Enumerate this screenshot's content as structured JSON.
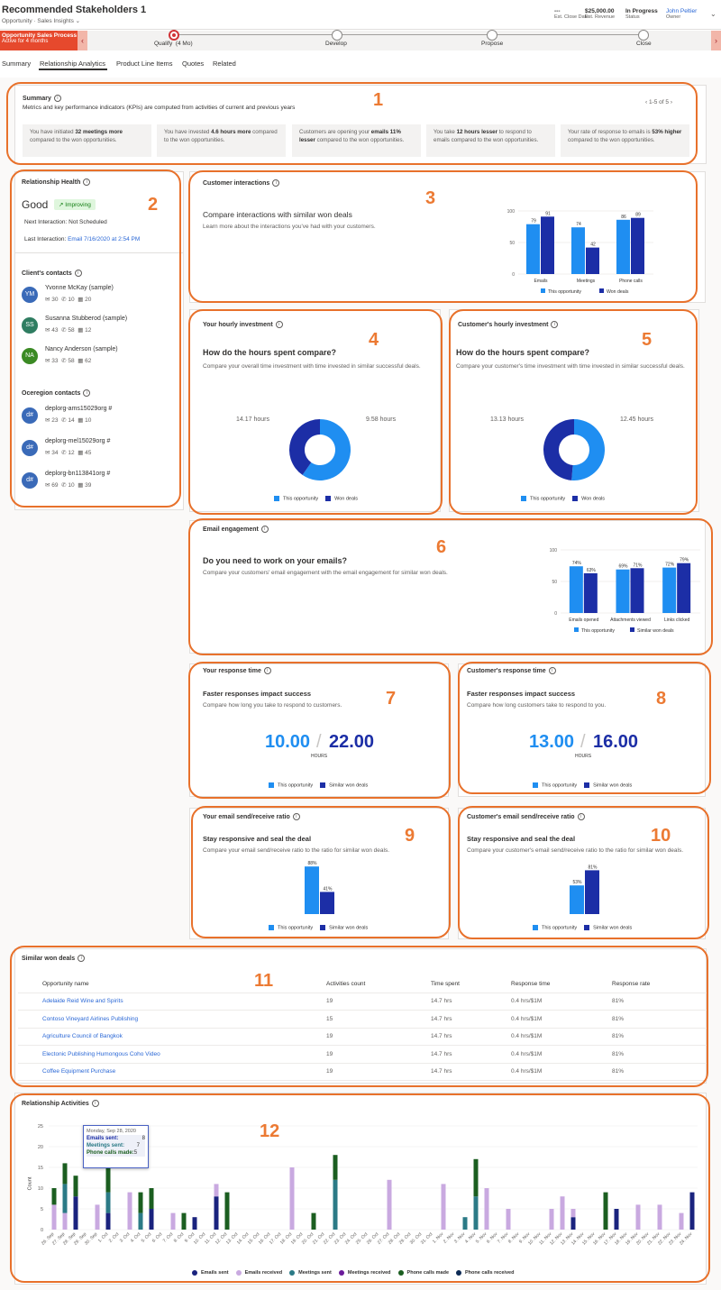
{
  "header": {
    "title": "Recommended Stakeholders 1",
    "entity": "Opportunity",
    "form": "Sales Insights",
    "close_date_value": "---",
    "close_date_label": "Est. Close Date",
    "revenue_value": "$25,000.00",
    "revenue_label": "Est. Revenue",
    "status_value": "In Progress",
    "status_label": "Status",
    "owner_value": "John Peltier",
    "owner_label": "Owner"
  },
  "process": {
    "name": "Opportunity Sales Process",
    "duration": "Active for 4 months",
    "stages": [
      "Qualify  (4 Mo)",
      "Develop",
      "Propose",
      "Close"
    ]
  },
  "tabs": [
    "Summary",
    "Relationship Analytics",
    "Product Line Items",
    "Quotes",
    "Related"
  ],
  "summary": {
    "title": "Summary",
    "desc": "Metrics and key performance indicators (KPIs) are computed from activities of current and previous years",
    "pager": "1-5 of 5",
    "kpis": [
      {
        "a": "You have initiated ",
        "b": "32 meetings more",
        "c": " compared to the won opportunities."
      },
      {
        "a": "You have invested ",
        "b": "4.6 hours more",
        "c": " compared to the won opportunities."
      },
      {
        "a": "Customers are opening your ",
        "b": "emails 11% lesser",
        "c": " compared to the won opportunities."
      },
      {
        "a": "You take ",
        "b": "12 hours lesser",
        "c": " to respond to emails compared to the won opportunities."
      },
      {
        "a": "Your rate of response to emails is ",
        "b": "53% higher",
        "c": " compared to the won opportunities."
      }
    ]
  },
  "health": {
    "title": "Relationship Health",
    "value": "Good",
    "trend": "Improving",
    "next_label": "Next Interaction: Not Scheduled",
    "last_label": "Last Interaction: ",
    "last_value": "Email 7/16/2020 at 2:54 PM",
    "clients_title": "Client's contacts",
    "clients": [
      {
        "initials": "YM",
        "name": "Yvonne McKay (sample)",
        "emails": "30",
        "calls": "10",
        "meetings": "20",
        "color": "#3a6ab8"
      },
      {
        "initials": "SS",
        "name": "Susanna Stubberod (sample)",
        "emails": "43",
        "calls": "58",
        "meetings": "12",
        "color": "#2f7d61"
      },
      {
        "initials": "NA",
        "name": "Nancy Anderson (sample)",
        "emails": "33",
        "calls": "58",
        "meetings": "62",
        "color": "#3b8a24"
      }
    ],
    "org_title": "Oceregion contacts",
    "org": [
      {
        "initials": "d#",
        "name": "deplorg-ams15029org #",
        "emails": "23",
        "calls": "14",
        "meetings": "10"
      },
      {
        "initials": "d#",
        "name": "deplorg-mel15029org #",
        "emails": "34",
        "calls": "12",
        "meetings": "45"
      },
      {
        "initials": "d#",
        "name": "deplorg-bn113841org #",
        "emails": "69",
        "calls": "10",
        "meetings": "39"
      }
    ]
  },
  "interactions": {
    "title": "Customer interactions",
    "heading": "Compare interactions with similar won deals",
    "desc": "Learn more about the interactions you've had with your customers."
  },
  "hourly": {
    "title": "Your hourly investment",
    "heading": "How do the hours spent compare?",
    "desc": "Compare your overall time investment with time invested in similar successful deals.",
    "left": "14.17 hours",
    "right": "9.58 hours"
  },
  "cust_hourly": {
    "title": "Customer's hourly investment",
    "heading": "How do the hours spent compare?",
    "desc": "Compare your customer's time investment with time invested in similar successful deals.",
    "left": "13.13 hours",
    "right": "12.45 hours"
  },
  "email": {
    "title": "Email engagement",
    "heading": "Do you need to work on your emails?",
    "desc": "Compare your customers' email engagement with the email engagement for similar won deals."
  },
  "resp": {
    "title": "Your response time",
    "heading": "Faster responses impact success",
    "desc": "Compare how long you take to respond to customers.",
    "a": "10.00",
    "b": "22.00",
    "unit": "HOURS"
  },
  "cust_resp": {
    "title": "Customer's response time",
    "heading": "Faster responses impact success",
    "desc": "Compare how long customers take to respond to you.",
    "a": "13.00",
    "b": "16.00",
    "unit": "HOURS"
  },
  "ratio": {
    "title": "Your email send/receive ratio",
    "heading": "Stay responsive and seal the deal",
    "desc": "Compare your email send/receive ratio to the ratio for similar won deals."
  },
  "cust_ratio": {
    "title": "Customer's email send/receive ratio",
    "heading": "Stay responsive and seal the deal",
    "desc": "Compare your customer's email send/receive ratio to the ratio for similar won deals."
  },
  "legend": {
    "this": "This opportunity",
    "won": "Won deals",
    "similar": "Similar won deals"
  },
  "won": {
    "title": "Similar won deals",
    "columns": [
      "Opportunity name",
      "Activities count",
      "Time spent",
      "Response time",
      "Response rate"
    ],
    "rows": [
      [
        "Adelaide Reid Wine and Spirits",
        "19",
        "14.7 hrs",
        "0.4 hrs/$1M",
        "81%"
      ],
      [
        "Contoso Vineyard Airlines Publishing",
        "15",
        "14.7 hrs",
        "0.4 hrs/$1M",
        "81%"
      ],
      [
        "Agriculture Council of Bangkok",
        "19",
        "14.7 hrs",
        "0.4 hrs/$1M",
        "81%"
      ],
      [
        "Electonic Publishing Humongous Coho Video",
        "19",
        "14.7 hrs",
        "0.4 hrs/$1M",
        "81%"
      ],
      [
        "Coffee Equipment Purchase",
        "19",
        "14.7 hrs",
        "0.4 hrs/$1M",
        "81%"
      ]
    ]
  },
  "activities": {
    "title": "Relationship Activities",
    "ylabel": "Count",
    "tooltip": {
      "date": "Monday, Sep 28, 2020",
      "emails": "Emails sent:",
      "emails_v": "8",
      "meetings": "Meetings sent:",
      "meetings_v": "7",
      "calls": "Phone calls made:",
      "calls_v": "5"
    }
  },
  "markers": [
    "1",
    "2",
    "3",
    "4",
    "5",
    "6",
    "7",
    "8",
    "9",
    "10",
    "11",
    "12"
  ],
  "chart_data": [
    {
      "type": "bar",
      "categories": [
        "Emails",
        "Meetings",
        "Phone calls"
      ],
      "series": [
        {
          "name": "This opportunity",
          "values": [
            79,
            74,
            86
          ]
        },
        {
          "name": "Won deals",
          "values": [
            91,
            42,
            89
          ]
        }
      ],
      "ylim": [
        0,
        100
      ],
      "yticks": [
        0,
        50,
        100
      ]
    },
    {
      "type": "pie",
      "labels": [
        "This opportunity",
        "Won deals"
      ],
      "values": [
        14.17,
        9.58
      ],
      "unit": "hours"
    },
    {
      "type": "pie",
      "labels": [
        "This opportunity",
        "Won deals"
      ],
      "values": [
        13.13,
        12.45
      ],
      "unit": "hours"
    },
    {
      "type": "bar",
      "categories": [
        "Emails opened",
        "Attachments viewed",
        "Links clicked"
      ],
      "series": [
        {
          "name": "This opportunity",
          "values": [
            74,
            69,
            72
          ]
        },
        {
          "name": "Similar won deals",
          "values": [
            63,
            71,
            79
          ]
        }
      ],
      "ylim": [
        0,
        100
      ],
      "yticks": [
        0,
        50,
        100
      ],
      "value_suffix": "%"
    },
    {
      "type": "bar",
      "categories": [
        ""
      ],
      "series": [
        {
          "name": "This opportunity",
          "values": [
            88
          ]
        },
        {
          "name": "Similar won deals",
          "values": [
            41
          ]
        }
      ],
      "ylim": [
        0,
        100
      ],
      "value_suffix": "%"
    },
    {
      "type": "bar",
      "categories": [
        ""
      ],
      "series": [
        {
          "name": "This opportunity",
          "values": [
            53
          ]
        },
        {
          "name": "Similar won deals",
          "values": [
            81
          ]
        }
      ],
      "ylim": [
        0,
        100
      ],
      "value_suffix": "%"
    },
    {
      "type": "bar",
      "stacked": true,
      "ylim": [
        0,
        25
      ],
      "yticks": [
        0,
        5,
        10,
        15,
        20,
        25
      ],
      "ylabel": "Count",
      "categories": [
        "26. Sep",
        "27. Sep",
        "28. Sep",
        "29. Sep",
        "30. Sep",
        "1. Oct",
        "2. Oct",
        "3. Oct",
        "4. Oct",
        "5. Oct",
        "6. Oct",
        "7. Oct",
        "8. Oct",
        "9. Oct",
        "10. Oct",
        "11. Oct",
        "12. Oct",
        "13. Oct",
        "14. Oct",
        "15. Oct",
        "16. Oct",
        "17. Oct",
        "18. Oct",
        "19. Oct",
        "20. Oct",
        "21. Oct",
        "22. Oct",
        "23. Oct",
        "24. Oct",
        "25. Oct",
        "26. Oct",
        "27. Oct",
        "28. Oct",
        "29. Oct",
        "30. Oct",
        "31. Oct",
        "1. Nov",
        "2. Nov",
        "3. Nov",
        "4. Nov",
        "5. Nov",
        "6. Nov",
        "7. Nov",
        "8. Nov",
        "9. Nov",
        "10. Nov",
        "11. Nov",
        "12. Nov",
        "13. Nov",
        "14. Nov",
        "15. Nov",
        "16. Nov",
        "17. Nov",
        "18. Nov",
        "19. Nov",
        "20. Nov",
        "21. Nov",
        "22. Nov",
        "23. Nov",
        "24. Nov"
      ],
      "series": [
        {
          "name": "Emails sent",
          "color": "#1a237e",
          "values": [
            0,
            0,
            8,
            0,
            0,
            4,
            0,
            0,
            0,
            5,
            0,
            0,
            0,
            3,
            0,
            8,
            0,
            0,
            0,
            0,
            0,
            0,
            0,
            0,
            0,
            0,
            0,
            0,
            0,
            0,
            0,
            0,
            0,
            0,
            0,
            0,
            0,
            0,
            0,
            0,
            0,
            0,
            0,
            0,
            0,
            0,
            0,
            0,
            3,
            0,
            0,
            0,
            5,
            0,
            0,
            0,
            0,
            0,
            0,
            9
          ]
        },
        {
          "name": "Emails received",
          "color": "#c9a9e0",
          "values": [
            6,
            4,
            0,
            0,
            6,
            0,
            0,
            9,
            0,
            0,
            0,
            4,
            0,
            0,
            0,
            3,
            0,
            0,
            0,
            0,
            0,
            0,
            15,
            0,
            0,
            0,
            0,
            0,
            0,
            0,
            0,
            12,
            0,
            0,
            0,
            0,
            11,
            0,
            0,
            0,
            10,
            0,
            5,
            0,
            0,
            0,
            5,
            8,
            2,
            0,
            0,
            0,
            0,
            0,
            6,
            0,
            6,
            0,
            4,
            0
          ]
        },
        {
          "name": "Meetings sent",
          "color": "#2b7a86",
          "values": [
            0,
            7,
            0,
            0,
            0,
            5,
            0,
            0,
            4,
            0,
            0,
            0,
            0,
            0,
            0,
            0,
            0,
            0,
            0,
            0,
            0,
            0,
            0,
            0,
            0,
            0,
            12,
            0,
            0,
            0,
            0,
            0,
            0,
            0,
            0,
            0,
            0,
            0,
            3,
            8,
            0,
            0,
            0,
            0,
            0,
            0,
            0,
            0,
            0,
            0,
            0,
            0,
            0,
            0,
            0,
            0,
            0,
            0,
            0,
            0
          ]
        },
        {
          "name": "Meetings received",
          "color": "#6a1b9a",
          "values": [
            0,
            0,
            0,
            0,
            0,
            0,
            0,
            0,
            0,
            0,
            0,
            0,
            0,
            0,
            0,
            0,
            0,
            0,
            0,
            0,
            0,
            0,
            0,
            0,
            0,
            0,
            0,
            0,
            0,
            0,
            0,
            0,
            0,
            0,
            0,
            0,
            0,
            0,
            0,
            0,
            0,
            0,
            0,
            0,
            0,
            0,
            0,
            0,
            0,
            0,
            0,
            0,
            0,
            0,
            0,
            0,
            0,
            0,
            0,
            0
          ]
        },
        {
          "name": "Phone calls made",
          "color": "#1b5e20",
          "values": [
            4,
            5,
            5,
            0,
            0,
            9,
            0,
            0,
            5,
            5,
            0,
            0,
            4,
            0,
            0,
            0,
            9,
            0,
            0,
            0,
            0,
            0,
            0,
            0,
            4,
            0,
            6,
            0,
            0,
            0,
            0,
            0,
            0,
            0,
            0,
            0,
            0,
            0,
            0,
            9,
            0,
            0,
            0,
            0,
            0,
            0,
            0,
            0,
            0,
            0,
            0,
            9,
            0,
            0,
            0,
            0,
            0,
            0,
            0,
            0
          ]
        },
        {
          "name": "Phone calls received",
          "color": "#0d2b55",
          "values": [
            0,
            0,
            0,
            0,
            0,
            0,
            0,
            0,
            0,
            0,
            0,
            0,
            0,
            0,
            0,
            0,
            0,
            0,
            0,
            0,
            0,
            0,
            0,
            0,
            0,
            0,
            0,
            0,
            0,
            0,
            0,
            0,
            0,
            0,
            0,
            0,
            0,
            0,
            0,
            0,
            0,
            0,
            0,
            0,
            0,
            0,
            0,
            0,
            0,
            0,
            0,
            0,
            0,
            0,
            0,
            0,
            0,
            0,
            0,
            0
          ]
        }
      ]
    }
  ]
}
